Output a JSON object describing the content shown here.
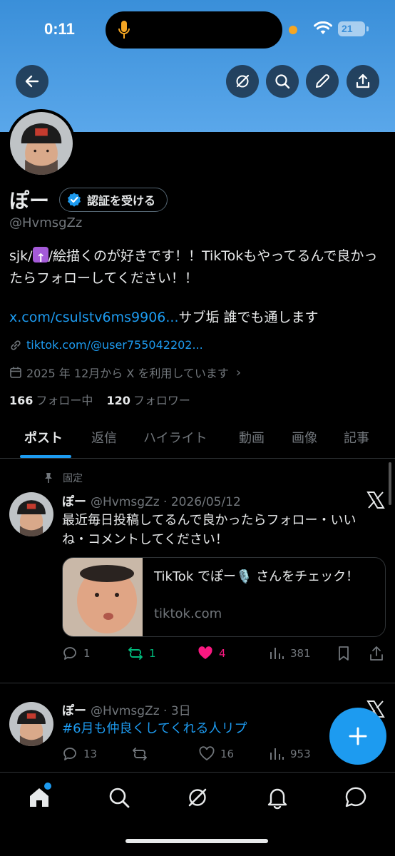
{
  "status_bar": {
    "time": "0:11",
    "battery": "21"
  },
  "profile": {
    "display_name": "ぽー",
    "verify_label": "認証を受ける",
    "handle": "@HvmsgZz",
    "bio_part1": "sjk/",
    "bio_part2": "/絵描くのが好きです！！TikTokもやってるんで良かったらフォローしてください！！",
    "link1": "x.com/csulstv6ms9906...",
    "link1_suffix": "サブ垢 誰でも通します",
    "website": "tiktok.com/@user755042202...",
    "joined": "2025 年 12月から X を利用しています",
    "following_count": "166",
    "following_label": "フォロー中",
    "followers_count": "120",
    "followers_label": "フォロワー"
  },
  "tabs": [
    "ポスト",
    "返信",
    "ハイライト",
    "動画",
    "画像",
    "記事"
  ],
  "pinned_label": "固定",
  "posts": [
    {
      "name": "ぽー",
      "handle_date": "@HvmsgZz · 2026/05/12",
      "text": "最近毎日投稿してるんで良かったらフォロー・いいね・コメントしてください！",
      "card_title": "TikTok でぽー🎙️ さんをチェック！",
      "card_domain": "tiktok.com",
      "replies": "1",
      "reposts": "1",
      "likes": "4",
      "views": "381"
    },
    {
      "name": "ぽー",
      "handle_date": "@HvmsgZz · 3日",
      "text": "#6月も仲良くしてくれる人リプ",
      "replies": "13",
      "reposts": "",
      "likes": "16",
      "views": "953"
    }
  ],
  "colors": {
    "accent": "#1d9bf0",
    "banner": "#4a9be2",
    "repost": "#00ba7c",
    "like": "#f91880"
  }
}
